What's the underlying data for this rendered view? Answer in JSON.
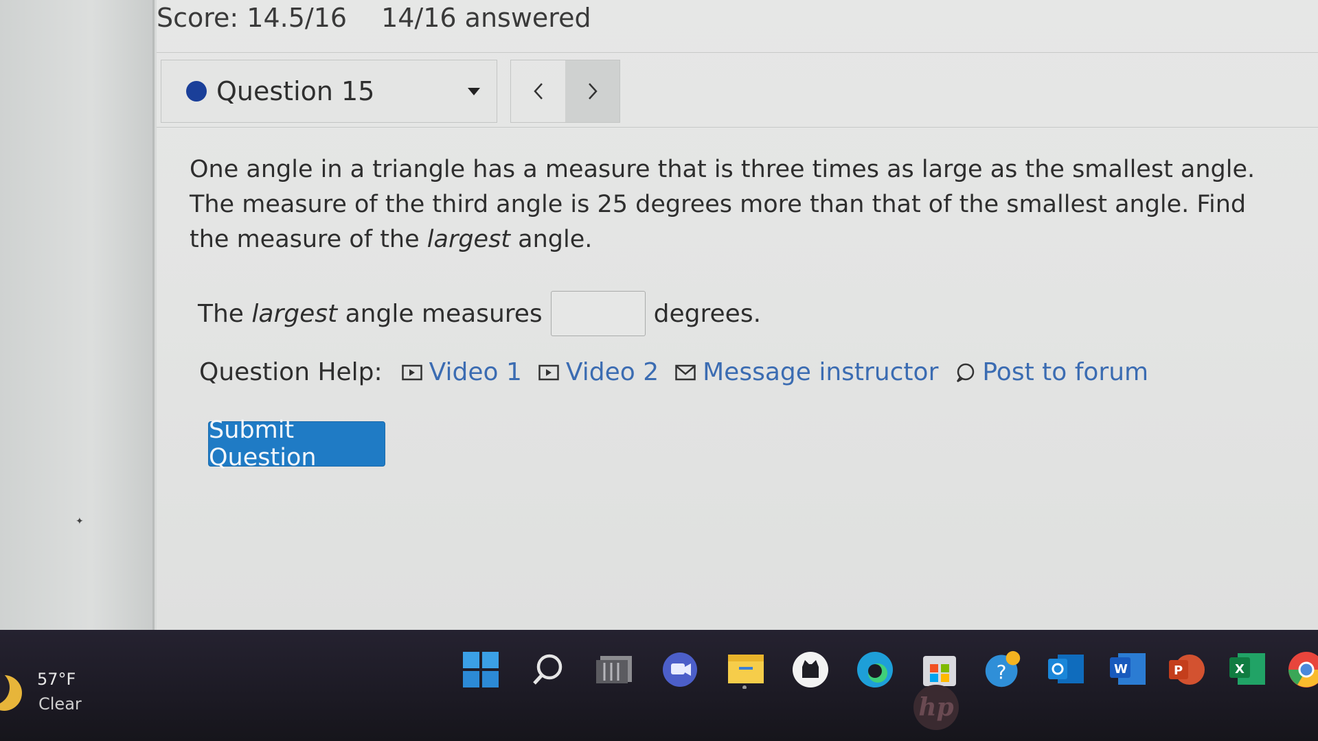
{
  "header": {
    "score": "Score: 14.5/16",
    "answered": "14/16 answered"
  },
  "question_nav": {
    "selected_question": "Question 15",
    "status_color": "#1a3f99",
    "prev_label": "<",
    "next_label": ">"
  },
  "question": {
    "part1": "One angle in a triangle has a measure that is three times as large as the smallest angle. The measure of the third angle is 25 degrees more than that of the smallest angle. Find the measure of the ",
    "emphasis": "largest",
    "part2": " angle."
  },
  "answer": {
    "prefix": "The ",
    "emphasis": "largest",
    "middle": " angle measures",
    "value": "",
    "suffix": "degrees."
  },
  "help": {
    "label": "Question Help:",
    "video1": "Video 1",
    "video2": "Video 2",
    "message": "Message instructor",
    "forum": "Post to forum"
  },
  "submit": {
    "label": "Submit Question",
    "color": "#1f7bc5"
  },
  "taskbar": {
    "weather_temp": "57°F",
    "weather_condition": "Clear",
    "icons": [
      "windows-start-icon",
      "search-icon",
      "file-viewer-icon",
      "teams-chat-icon",
      "file-explorer-icon",
      "github-icon",
      "edge-browser-icon",
      "microsoft-store-icon",
      "get-help-icon",
      "outlook-icon",
      "word-icon",
      "powerpoint-icon",
      "excel-icon",
      "chrome-icon"
    ]
  },
  "brand": {
    "laptop_logo": "hp"
  }
}
